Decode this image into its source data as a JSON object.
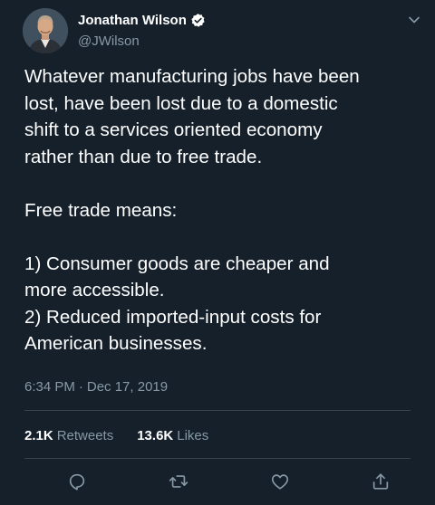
{
  "author": {
    "display_name": "Jonathan Wilson",
    "handle": "@JWilson",
    "verified": true,
    "avatar_icon": "person-portrait"
  },
  "tweet": {
    "text": "Whatever manufacturing jobs have been\nlost, have been lost due to a domestic\nshift to a services oriented economy\nrather than due to free trade.\n\nFree trade means:\n\n1) Consumer goods are cheaper and\nmore accessible.\n2) Reduced imported-input costs for\nAmerican businesses.",
    "time": "6:34 PM",
    "separator": "·",
    "date": "Dec 17, 2019"
  },
  "stats": {
    "retweets_count": "2.1K",
    "retweets_label": "Retweets",
    "likes_count": "13.6K",
    "likes_label": "Likes"
  },
  "actions": {
    "reply_icon": "reply-icon",
    "retweet_icon": "retweet-icon",
    "like_icon": "like-icon",
    "share_icon": "share-icon"
  },
  "colors": {
    "background": "#15202b",
    "text_primary": "#ffffff",
    "text_secondary": "#8899a6",
    "divider": "#38444d",
    "accent": "#1da1f2"
  }
}
